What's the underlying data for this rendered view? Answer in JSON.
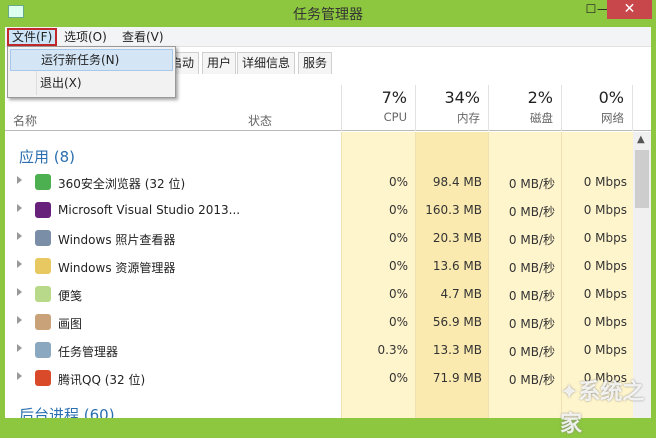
{
  "window": {
    "title": "任务管理器",
    "minimize": "—",
    "maximize": "☐",
    "close": "✕"
  },
  "menubar": {
    "items": [
      {
        "label": "文件(F)"
      },
      {
        "label": "选项(O)"
      },
      {
        "label": "查看(V)"
      }
    ]
  },
  "file_menu": {
    "items": [
      {
        "label": "运行新任务(N)",
        "highlighted": true
      },
      {
        "label": "退出(X)"
      }
    ]
  },
  "tabs": [
    {
      "label": "启动"
    },
    {
      "label": "用户"
    },
    {
      "label": "详细信息"
    },
    {
      "label": "服务"
    }
  ],
  "columns": {
    "name": "名称",
    "status": "状态",
    "cpu": {
      "pct": "7%",
      "label": "CPU"
    },
    "memory": {
      "pct": "34%",
      "label": "内存"
    },
    "disk": {
      "pct": "2%",
      "label": "磁盘"
    },
    "network": {
      "pct": "0%",
      "label": "网络"
    }
  },
  "groups": {
    "apps": "应用 (8)",
    "background": "后台进程 (60)"
  },
  "rows": [
    {
      "name": "360安全浏览器 (32 位)",
      "icon": "360-browser-icon",
      "cpu": "0%",
      "memory": "98.4 MB",
      "disk": "0 MB/秒",
      "network": "0 Mbps"
    },
    {
      "name": "Microsoft Visual Studio 2013...",
      "icon": "visual-studio-icon",
      "cpu": "0%",
      "memory": "160.3 MB",
      "disk": "0 MB/秒",
      "network": "0 Mbps"
    },
    {
      "name": "Windows 照片查看器",
      "icon": "photo-viewer-icon",
      "cpu": "0%",
      "memory": "20.3 MB",
      "disk": "0 MB/秒",
      "network": "0 Mbps"
    },
    {
      "name": "Windows 资源管理器",
      "icon": "explorer-icon",
      "cpu": "0%",
      "memory": "13.6 MB",
      "disk": "0 MB/秒",
      "network": "0 Mbps"
    },
    {
      "name": "便笺",
      "icon": "sticky-notes-icon",
      "cpu": "0%",
      "memory": "4.7 MB",
      "disk": "0 MB/秒",
      "network": "0 Mbps"
    },
    {
      "name": "画图",
      "icon": "paint-icon",
      "cpu": "0%",
      "memory": "56.9 MB",
      "disk": "0 MB/秒",
      "network": "0 Mbps"
    },
    {
      "name": "任务管理器",
      "icon": "task-manager-icon",
      "cpu": "0.3%",
      "memory": "13.3 MB",
      "disk": "0 MB/秒",
      "network": "0 Mbps"
    },
    {
      "name": "腾讯QQ (32 位)",
      "icon": "qq-icon",
      "cpu": "0%",
      "memory": "71.9 MB",
      "disk": "0 MB/秒",
      "network": "0 Mbps"
    }
  ],
  "watermark": "系统之家",
  "colors": {
    "titlebar": "#8dc63f",
    "group": "#2b6fb0",
    "close": "#c7474a",
    "heat_light": "#fff5cc",
    "heat_mid": "#faeab0"
  }
}
